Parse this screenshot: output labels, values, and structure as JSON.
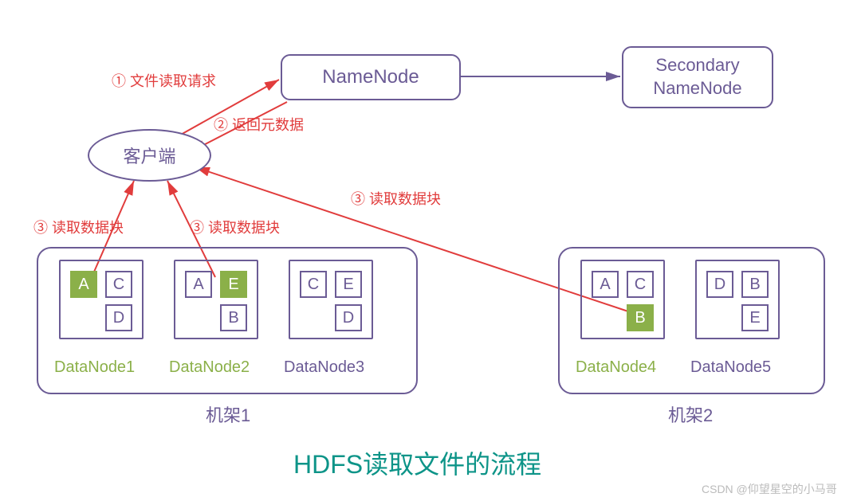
{
  "nodes": {
    "namenode": "NameNode",
    "secondary": "Secondary\nNameNode",
    "client": "客户端"
  },
  "labels": {
    "l1": "① 文件读取请求",
    "l2": "② 返回元数据",
    "l3a": "③ 读取数据块",
    "l3b": "③ 读取数据块",
    "l3c": "③ 读取数据块"
  },
  "rack1": {
    "label": "机架1",
    "dn1": {
      "name": "DataNode1",
      "blocks": [
        {
          "v": "A",
          "hl": true
        },
        {
          "v": "C",
          "hl": false
        },
        {
          "v": "D",
          "hl": false
        }
      ]
    },
    "dn2": {
      "name": "DataNode2",
      "blocks": [
        {
          "v": "A",
          "hl": false
        },
        {
          "v": "E",
          "hl": true
        },
        {
          "v": "B",
          "hl": false
        }
      ]
    },
    "dn3": {
      "name": "DataNode3",
      "blocks": [
        {
          "v": "C",
          "hl": false
        },
        {
          "v": "E",
          "hl": false
        },
        {
          "v": "D",
          "hl": false
        }
      ]
    }
  },
  "rack2": {
    "label": "机架2",
    "dn4": {
      "name": "DataNode4",
      "blocks": [
        {
          "v": "A",
          "hl": false
        },
        {
          "v": "C",
          "hl": false
        },
        {
          "v": "B",
          "hl": true
        }
      ]
    },
    "dn5": {
      "name": "DataNode5",
      "blocks": [
        {
          "v": "D",
          "hl": false
        },
        {
          "v": "B",
          "hl": false
        },
        {
          "v": "E",
          "hl": false
        }
      ]
    }
  },
  "title": "HDFS读取文件的流程",
  "watermark": "CSDN @仰望星空的小马哥"
}
